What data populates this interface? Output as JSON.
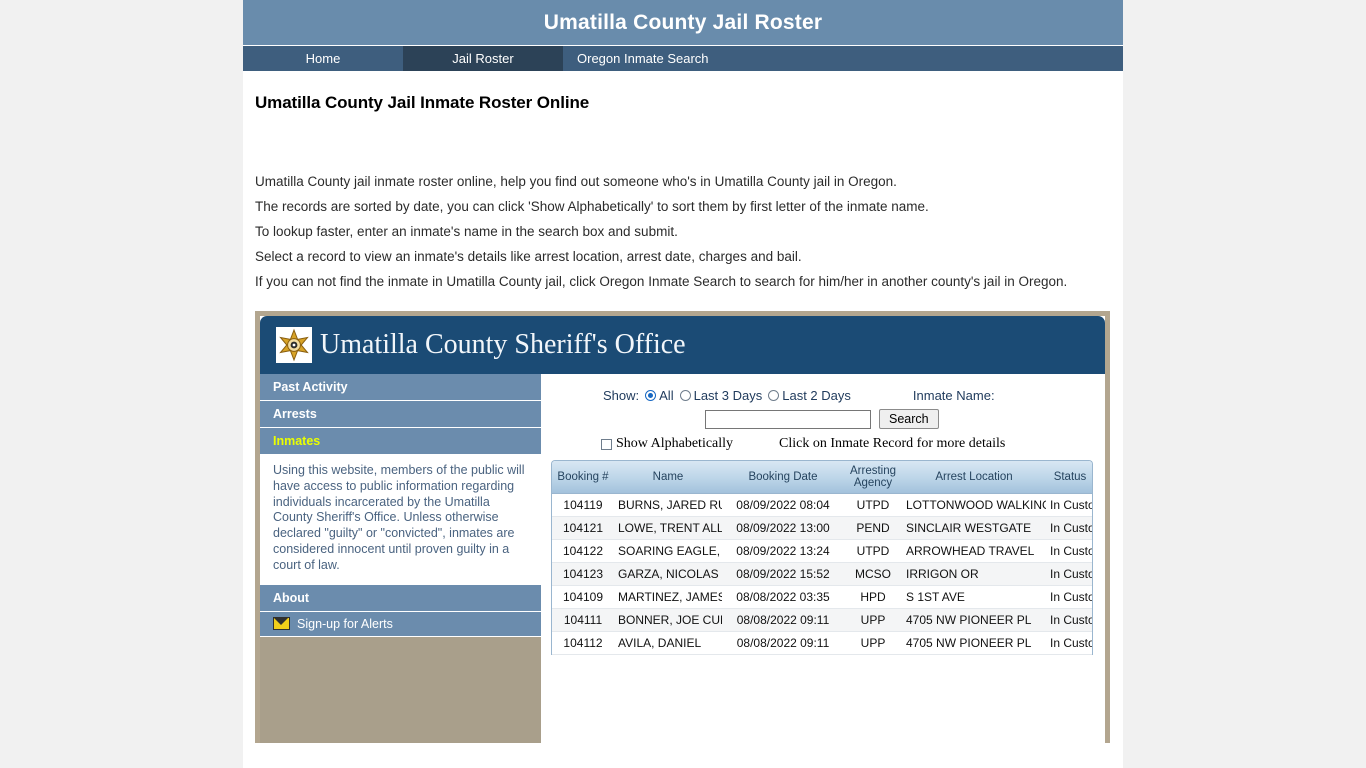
{
  "header": {
    "title": "Umatilla County Jail Roster"
  },
  "nav": {
    "items": [
      {
        "label": "Home",
        "active": false
      },
      {
        "label": "Jail Roster",
        "active": true
      },
      {
        "label": "Oregon Inmate Search",
        "active": false
      }
    ]
  },
  "intro": {
    "heading": "Umatilla County Jail Inmate Roster Online",
    "paragraphs": [
      "Umatilla County jail inmate roster online, help you find out someone who's in Umatilla County jail in Oregon.",
      "The records are sorted by date, you can click 'Show Alphabetically' to sort them by first letter of the inmate name.",
      "To lookup faster, enter an inmate's name in the search box and submit.",
      "Select a record to view an inmate's details like arrest location, arrest date, charges and bail.",
      "If you can not find the inmate in Umatilla County jail, click Oregon Inmate Search to search for him/her in another county's jail in Oregon."
    ]
  },
  "widget": {
    "title": "Umatilla County Sheriff's Office",
    "sidebar": {
      "past_activity": "Past Activity",
      "arrests": "Arrests",
      "inmates": "Inmates",
      "disclaimer": "Using this website, members of the public will have access to public information regarding individuals incarcerated by the Umatilla County Sheriff's Office. Unless otherwise declared \"guilty\" or \"convicted\", inmates are considered innocent until proven guilty in a court of law.",
      "about": "About",
      "alerts": "Sign-up for Alerts"
    },
    "filters": {
      "show_label": "Show:",
      "all": "All",
      "last3": "Last 3 Days",
      "last2": "Last 2 Days",
      "inmate_name_label": "Inmate Name:",
      "search_value": "",
      "search_placeholder": "",
      "search_button": "Search",
      "show_alphabetically": "Show Alphabetically",
      "hint": "Click on Inmate Record for more details"
    },
    "table": {
      "columns": [
        "Booking #",
        "Name",
        "Booking Date",
        "Arresting Agency",
        "Arrest Location",
        "Status"
      ],
      "rows": [
        {
          "booking": "104119",
          "name": "BURNS, JARED RUSSELL",
          "date": "08/09/2022 08:04",
          "agency": "UTPD",
          "location": "LOTTONWOOD WALKING",
          "status": "In Custody"
        },
        {
          "booking": "104121",
          "name": "LOWE, TRENT ALLEN",
          "date": "08/09/2022 13:00",
          "agency": "PEND",
          "location": "SINCLAIR WESTGATE",
          "status": "In Custody"
        },
        {
          "booking": "104122",
          "name": "SOARING EAGLE, THOMAS",
          "date": "08/09/2022 13:24",
          "agency": "UTPD",
          "location": "ARROWHEAD TRAVEL",
          "status": "In Custody"
        },
        {
          "booking": "104123",
          "name": "GARZA, NICOLAS LANDEROS",
          "date": "08/09/2022 15:52",
          "agency": "MCSO",
          "location": "IRRIGON OR",
          "status": "In Custody"
        },
        {
          "booking": "104109",
          "name": "MARTINEZ, JAMES JOSEPH",
          "date": "08/08/2022 03:35",
          "agency": "HPD",
          "location": "S 1ST AVE",
          "status": "In Custody"
        },
        {
          "booking": "104111",
          "name": "BONNER, JOE CUMMINGS",
          "date": "08/08/2022 09:11",
          "agency": "UPP",
          "location": "4705 NW PIONEER PL",
          "status": "In Custody"
        },
        {
          "booking": "104112",
          "name": "AVILA, DANIEL",
          "date": "08/08/2022 09:11",
          "agency": "UPP",
          "location": "4705 NW PIONEER PL",
          "status": "In Custody"
        }
      ]
    }
  },
  "colors": {
    "header_bg": "#698cac",
    "nav_bg": "#3e5e7e",
    "nav_active_bg": "#2c4257",
    "widget_header_bg": "#1b4b75",
    "sidebar_item_bg": "#6b8cad",
    "sidebar_selected_text": "#eaff00",
    "frame_border": "#b3a68f",
    "sidebar_filler": "#a99f8b",
    "table_header_bg": "#bcd5e8"
  }
}
